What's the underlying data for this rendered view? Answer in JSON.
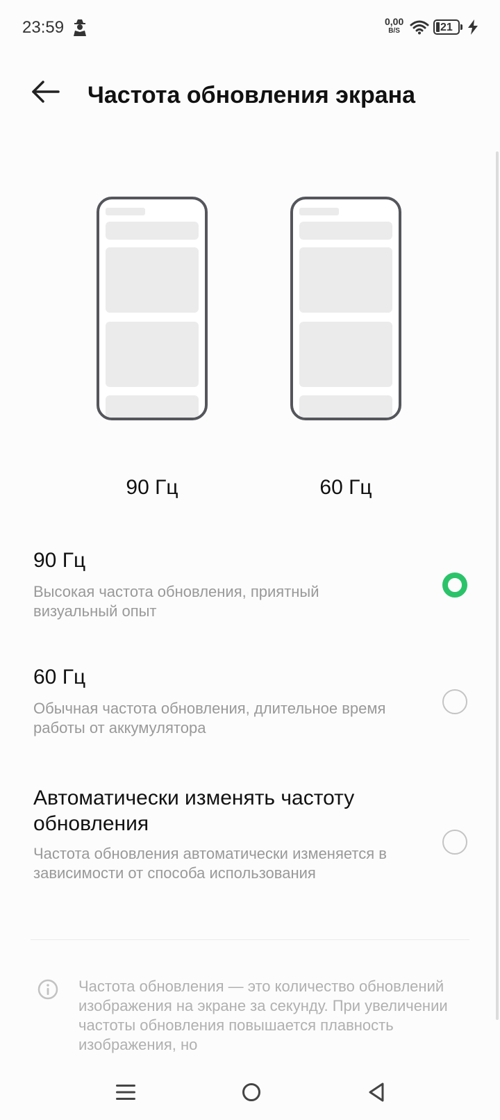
{
  "status_bar": {
    "time": "23:59",
    "net_speed_value": "0,00",
    "net_speed_unit": "B/S",
    "battery_level": "21",
    "icons": [
      "spy-icon",
      "wifi-icon",
      "battery-icon",
      "charging-icon"
    ]
  },
  "header": {
    "back_icon": "arrow-left-icon",
    "title": "Частота обновления экрана"
  },
  "previews": [
    {
      "label": "90 Гц"
    },
    {
      "label": "60 Гц"
    }
  ],
  "options": [
    {
      "title": "90 Гц",
      "description": "Высокая частота обновления, приятный визуальный опыт",
      "selected": true
    },
    {
      "title": "60 Гц",
      "description": "Обычная частота обновления, длительное время работы от аккумулятора",
      "selected": false
    },
    {
      "title": "Автоматически изменять частоту обновления",
      "description": "Частота обновления автоматически изменяется в зависимости от способа использования",
      "selected": false
    }
  ],
  "info": {
    "icon": "info-icon",
    "text": "Частота обновления — это количество обновлений изображения на экране за секунду. При увеличении частоты обновления повышается плавность изображения, но"
  },
  "colors": {
    "accent": "#2bc36a",
    "radio_unchecked": "#c4c4c4",
    "secondary_text": "#999999"
  },
  "nav_bar": {
    "icons": [
      "menu-icon",
      "home-icon",
      "back-triangle-icon"
    ]
  }
}
